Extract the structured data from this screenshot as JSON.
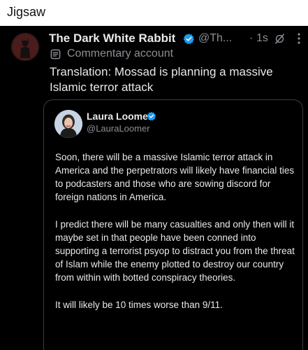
{
  "header": {
    "caption": "Jigsaw"
  },
  "post": {
    "display_name": "The Dark White Rabbit",
    "handle": "@Th...",
    "separator": "·",
    "time": "1s",
    "commentary_label": "Commentary account",
    "text": "Translation: Mossad is planning a massive Islamic terror attack",
    "icons": [
      "verified-badge-icon",
      "grok-icon",
      "more-icon",
      "commentary-account-icon"
    ],
    "accent_color": "#1d9bf0"
  },
  "quote": {
    "display_name": "Laura Loomer",
    "handle": "@LauraLoomer",
    "paragraphs": [
      "Soon, there will be a massive Islamic terror attack in America and the perpetrators will likely have financial ties to podcasters and those who are sowing discord for foreign nations in America.",
      "I predict there will be many casualties and only then will it maybe set in that people have been conned into supporting a terrorist psyop to distract you from the threat of Islam while the enemy plotted to destroy our country from within with botted conspiracy theories.",
      "It will likely be 10 times worse than 9/11."
    ]
  }
}
